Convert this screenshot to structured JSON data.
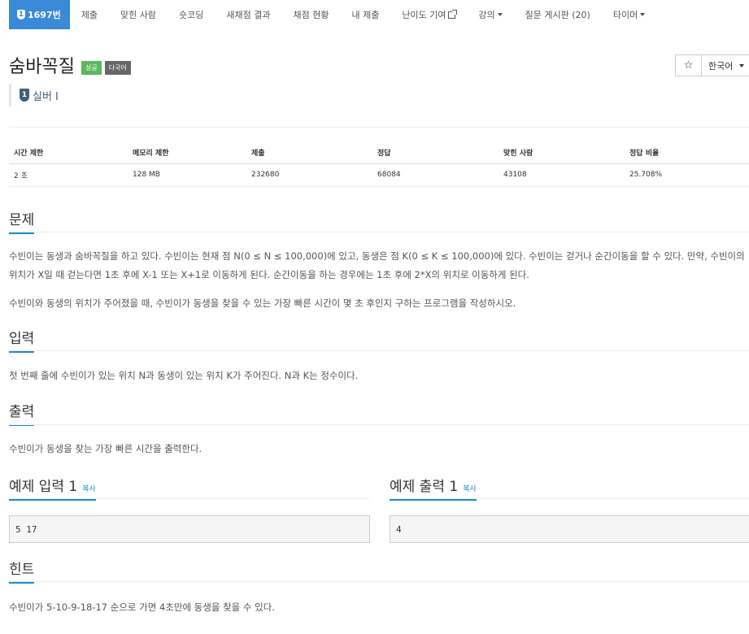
{
  "nav": {
    "problem_number": "1697번",
    "problem_badge": "1",
    "items": [
      {
        "label": "제출"
      },
      {
        "label": "맞힌 사람"
      },
      {
        "label": "숏코딩"
      },
      {
        "label": "새채점 결과"
      },
      {
        "label": "채점 현황"
      },
      {
        "label": "내 제출"
      },
      {
        "label": "난이도 기여"
      },
      {
        "label": "강의"
      },
      {
        "label": "질문 게시판 (20)"
      },
      {
        "label": "타이머"
      }
    ]
  },
  "problem": {
    "title": "숨바꼭질",
    "label_success": "성공",
    "label_multilang": "다국어",
    "tier_badge": "1",
    "tier": "실버 I"
  },
  "tools": {
    "star": "☆",
    "language": "한국어"
  },
  "info_table": {
    "headers": [
      "시간 제한",
      "메모리 제한",
      "제출",
      "정답",
      "맞힌 사람",
      "정답 비율"
    ],
    "values": [
      "2 초",
      "128 MB",
      "232680",
      "68084",
      "43108",
      "25.708%"
    ]
  },
  "sections": {
    "description_title": "문제",
    "description_p1": "수빈이는 동생과 숨바꼭질을 하고 있다. 수빈이는 현재 점 N(0 ≤ N ≤ 100,000)에 있고, 동생은 점 K(0 ≤ K ≤ 100,000)에 있다. 수빈이는 걷거나 순간이동을 할 수 있다. 만약, 수빈이의 위치가 X일 때 걷는다면 1초 후에 X-1 또는 X+1로 이동하게 된다. 순간이동을 하는 경우에는 1초 후에 2*X의 위치로 이동하게 된다.",
    "description_p2": "수빈이와 동생의 위치가 주어졌을 때, 수빈이가 동생을 찾을 수 있는 가장 빠른 시간이 몇 초 후인지 구하는 프로그램을 작성하시오.",
    "input_title": "입력",
    "input_text": "첫 번째 줄에 수빈이가 있는 위치 N과 동생이 있는 위치 K가 주어진다. N과 K는 정수이다.",
    "output_title": "출력",
    "output_text": "수빈이가 동생을 찾는 가장 빠른 시간을 출력한다.",
    "sample_input_title": "예제 입력 1",
    "sample_output_title": "예제 출력 1",
    "copy_label": "복사",
    "sample_input": "5 17",
    "sample_output": "4",
    "hint_title": "힌트",
    "hint_text": "수빈이가 5-10-9-18-17 순으로 가면 4초만에 동생을 찾을 수 있다."
  }
}
